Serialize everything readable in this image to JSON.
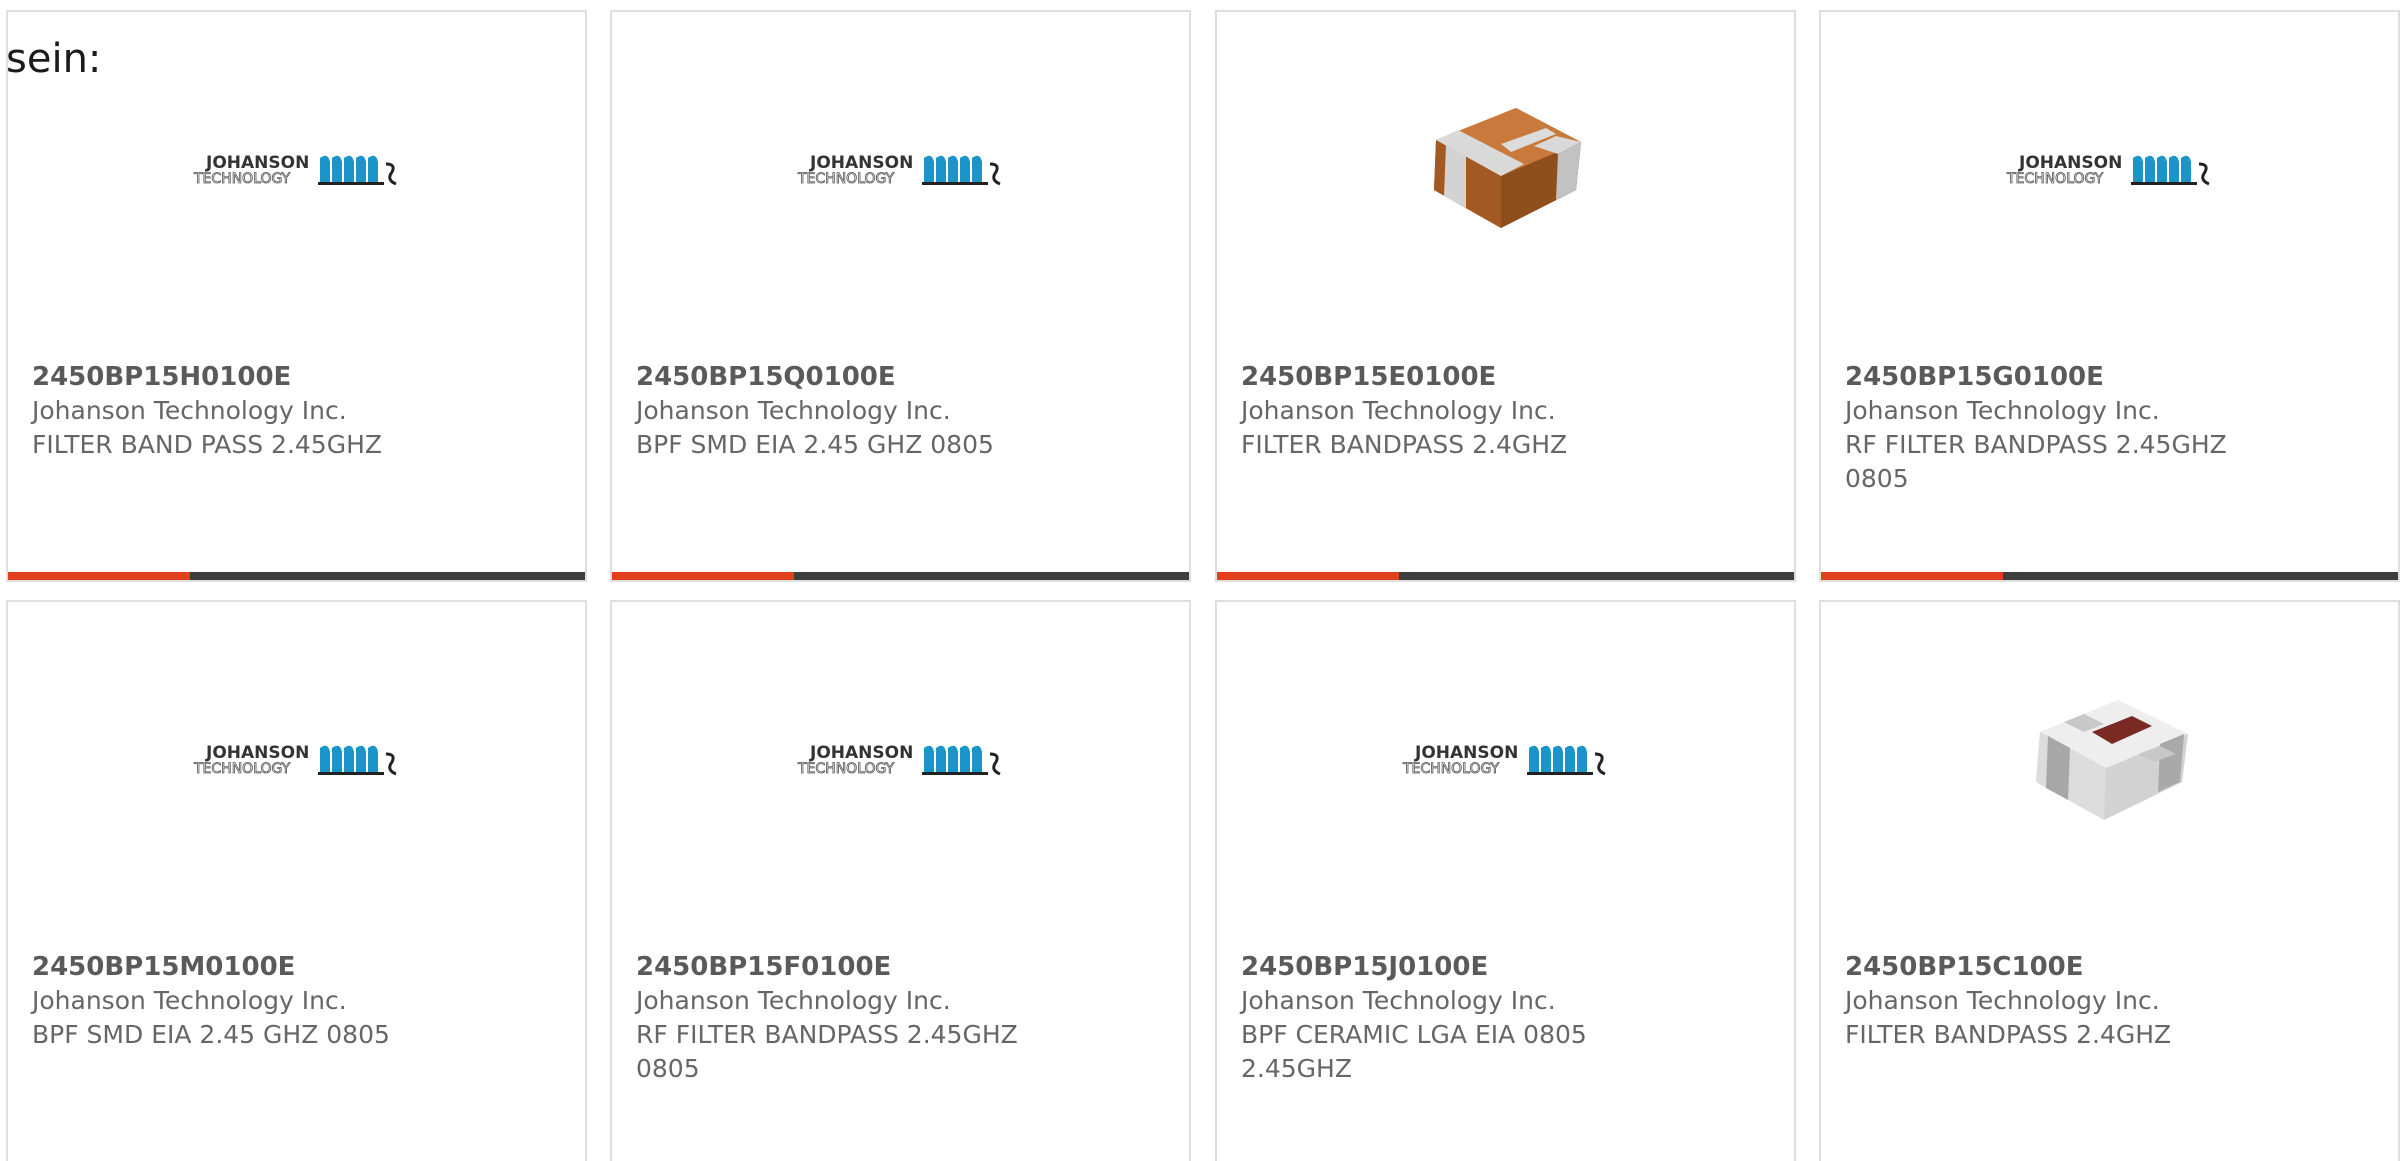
{
  "intro_text": "sein:",
  "colors": {
    "card_border": "#dedede",
    "text_gray": "#666666",
    "bar_dark": "#3e3e3e",
    "bar_accent": "#e2401a",
    "logo_blue": "#1b95c9"
  },
  "logo": {
    "line1": "JOHANSON",
    "line2": "TECHNOLOGY"
  },
  "products": [
    {
      "part_number": "2450BP15H0100E",
      "manufacturer": "Johanson Technology Inc.",
      "description": "FILTER BAND PASS 2.45GHZ",
      "image": "johanson-logo"
    },
    {
      "part_number": "2450BP15Q0100E",
      "manufacturer": "Johanson Technology Inc.",
      "description": "BPF SMD EIA 2.45 GHZ 0805",
      "image": "johanson-logo"
    },
    {
      "part_number": "2450BP15E0100E",
      "manufacturer": "Johanson Technology Inc.",
      "description": "FILTER BANDPASS 2.4GHZ",
      "image": "brown-chip-component"
    },
    {
      "part_number": "2450BP15G0100E",
      "manufacturer": "Johanson Technology Inc.",
      "description": "RF FILTER BANDPASS 2.45GHZ 0805",
      "image": "johanson-logo"
    },
    {
      "part_number": "2450BP15M0100E",
      "manufacturer": "Johanson Technology Inc.",
      "description": "BPF SMD EIA 2.45 GHZ 0805",
      "image": "johanson-logo"
    },
    {
      "part_number": "2450BP15F0100E",
      "manufacturer": "Johanson Technology Inc.",
      "description": "RF FILTER BANDPASS 2.45GHZ 0805",
      "image": "johanson-logo"
    },
    {
      "part_number": "2450BP15J0100E",
      "manufacturer": "Johanson Technology Inc.",
      "description": "BPF CERAMIC LGA EIA 0805 2.45GHZ",
      "image": "johanson-logo"
    },
    {
      "part_number": "2450BP15C100E",
      "manufacturer": "Johanson Technology Inc.",
      "description": "FILTER BANDPASS 2.4GHZ",
      "image": "white-chip-component"
    }
  ]
}
